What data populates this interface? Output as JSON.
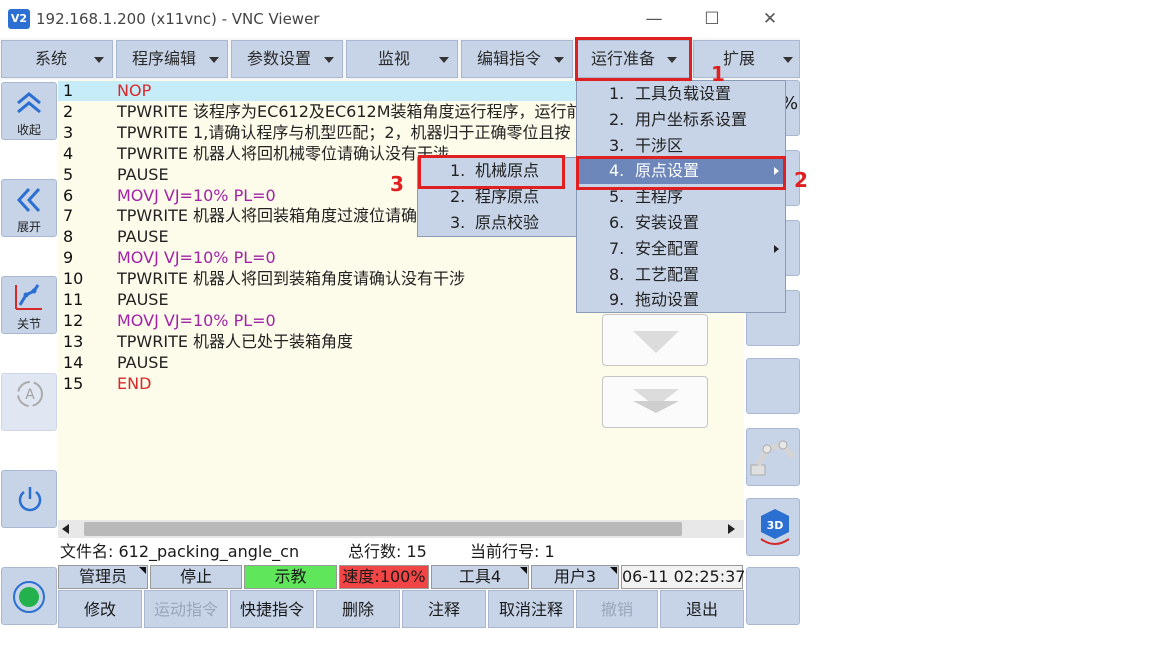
{
  "window": {
    "title": "192.168.1.200 (x11vnc) - VNC Viewer",
    "logo": "V2",
    "minimize": "—",
    "maximize": "☐",
    "close": "✕"
  },
  "menu": [
    "系统",
    "程序编辑",
    "参数设置",
    "监视",
    "编辑指令",
    "运行准备",
    "扩展"
  ],
  "sidebar": [
    {
      "label": "收起",
      "icon": "chevron-up-icon"
    },
    {
      "label": "展开",
      "icon": "chevron-left-icon"
    },
    {
      "label": "关节",
      "icon": "joint-axes-icon"
    },
    {
      "label": "",
      "icon": "auto-mode-icon"
    },
    {
      "label": "",
      "icon": "power-icon"
    },
    {
      "label": "",
      "icon": "record-icon"
    }
  ],
  "code_lines": [
    {
      "n": "1",
      "text": "NOP",
      "color": "red"
    },
    {
      "n": "2",
      "text": "TPWRITE 该程序为EC612及EC612M装箱角度运行程序，运行前",
      "color": "black"
    },
    {
      "n": "3",
      "text": "TPWRITE 1,请确认程序与机型匹配；2，机器归于正确零位且按",
      "color": "black"
    },
    {
      "n": "4",
      "text": "TPWRITE 机器人将回机械零位请确认没有干涉",
      "color": "black"
    },
    {
      "n": "5",
      "text": "PAUSE",
      "color": "black"
    },
    {
      "n": "6",
      "text": "MOVJ VJ=10% PL=0",
      "color": "purple"
    },
    {
      "n": "7",
      "text": "TPWRITE 机器人将回装箱角度过渡位请确",
      "color": "black"
    },
    {
      "n": "8",
      "text": "PAUSE",
      "color": "black"
    },
    {
      "n": "9",
      "text": "MOVJ VJ=10% PL=0",
      "color": "purple"
    },
    {
      "n": "10",
      "text": "TPWRITE 机器人将回到装箱角度请确认没有干涉",
      "color": "black"
    },
    {
      "n": "11",
      "text": "PAUSE",
      "color": "black"
    },
    {
      "n": "12",
      "text": "MOVJ VJ=10% PL=0",
      "color": "purple"
    },
    {
      "n": "13",
      "text": "TPWRITE 机器人已处于装箱角度",
      "color": "black"
    },
    {
      "n": "14",
      "text": "PAUSE",
      "color": "black"
    },
    {
      "n": "15",
      "text": "END",
      "color": "red"
    }
  ],
  "dropdown": [
    {
      "n": "1.",
      "label": "工具负载设置",
      "sub": false
    },
    {
      "n": "2.",
      "label": "用户坐标系设置",
      "sub": false
    },
    {
      "n": "3.",
      "label": "干涉区",
      "sub": false
    },
    {
      "n": "4.",
      "label": "原点设置",
      "sub": true
    },
    {
      "n": "5.",
      "label": "主程序",
      "sub": false
    },
    {
      "n": "6.",
      "label": "安装设置",
      "sub": false
    },
    {
      "n": "7.",
      "label": "安全配置",
      "sub": true
    },
    {
      "n": "8.",
      "label": "工艺配置",
      "sub": false
    },
    {
      "n": "9.",
      "label": "拖动设置",
      "sub": false
    }
  ],
  "submenu": [
    {
      "n": "1.",
      "label": "机械原点"
    },
    {
      "n": "2.",
      "label": "程序原点"
    },
    {
      "n": "3.",
      "label": "原点校验"
    }
  ],
  "annotations": [
    "1",
    "2",
    "3"
  ],
  "right_partial": [
    "%",
    ")"
  ],
  "info": {
    "file": "文件名: 612_packing_angle_cn",
    "total": "总行数: 15",
    "current": "当前行号: 1"
  },
  "status": [
    "管理员",
    "停止",
    "示教",
    "速度:100%",
    "工具4",
    "用户3",
    "06-11 02:25:37"
  ],
  "status_colors": {
    "teach": "#5fe65a",
    "speed": "#f24545"
  },
  "bottom": [
    "修改",
    "运动指令",
    "快捷指令",
    "删除",
    "注释",
    "取消注释",
    "撤销",
    "退出"
  ],
  "disabled_bottom": [
    "运动指令",
    "撤销"
  ]
}
